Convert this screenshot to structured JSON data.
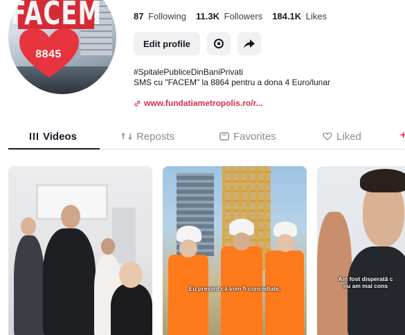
{
  "profile": {
    "avatar_sign_text": "FACEM",
    "avatar_number": "8845",
    "stats": [
      {
        "value": "87",
        "label": "Following"
      },
      {
        "value": "11.3K",
        "label": "Followers"
      },
      {
        "value": "184.1K",
        "label": "Likes"
      }
    ],
    "edit_profile_label": "Edit profile",
    "bio_line1": "#SpitalePubliceDinBaniPrivati",
    "bio_line2": "SMS cu \"FACEM\" la 8864 pentru a dona 4 Euro/lunar",
    "link_text": "www.fundatiametropolis.ro/r..."
  },
  "tabs": [
    {
      "label": "Videos",
      "icon": "grid-icon",
      "active": true
    },
    {
      "label": "Reposts",
      "icon": "repost-icon",
      "active": false
    },
    {
      "label": "Favorites",
      "icon": "bookmark-icon",
      "active": false
    },
    {
      "label": "Liked",
      "icon": "heart-outline-icon",
      "active": false
    }
  ],
  "videos": [
    {
      "caption": ""
    },
    {
      "caption": "Eu presimt că vom fi concediate,"
    },
    {
      "caption": "Am fost disperată c\nnu am mai cons"
    }
  ],
  "colors": {
    "accent": "#fe2c55",
    "link": "#d42c52",
    "vest": "#ff7a1a",
    "sign_red": "#d62b35"
  }
}
